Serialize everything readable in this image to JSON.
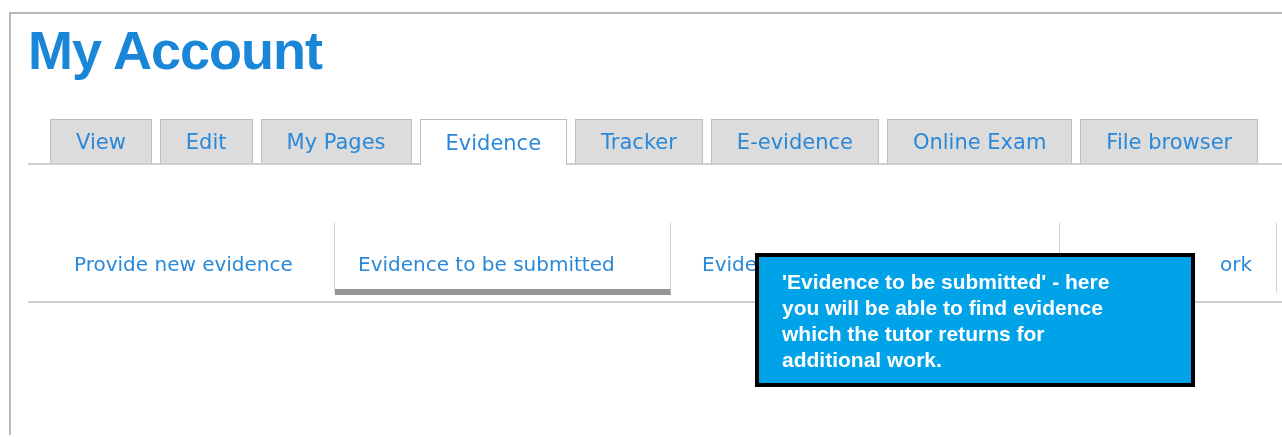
{
  "page_title": "My Account",
  "tabs": [
    {
      "label": "View",
      "selected": false
    },
    {
      "label": "Edit",
      "selected": false
    },
    {
      "label": "My Pages",
      "selected": false
    },
    {
      "label": "Evidence",
      "selected": true
    },
    {
      "label": "Tracker",
      "selected": false
    },
    {
      "label": "E-evidence",
      "selected": false
    },
    {
      "label": "Online Exam",
      "selected": false
    },
    {
      "label": "File browser",
      "selected": false
    }
  ],
  "subtabs": [
    {
      "label": "Provide new evidence",
      "selected": false
    },
    {
      "label": "Evidence to be submitted",
      "selected": true
    },
    {
      "label": "Evide",
      "selected": false
    },
    {
      "label": "ork",
      "selected": false
    }
  ],
  "callout": {
    "text": "'Evidence to be submitted' - here you will be able to find evidence which the tutor returns for additional work."
  }
}
